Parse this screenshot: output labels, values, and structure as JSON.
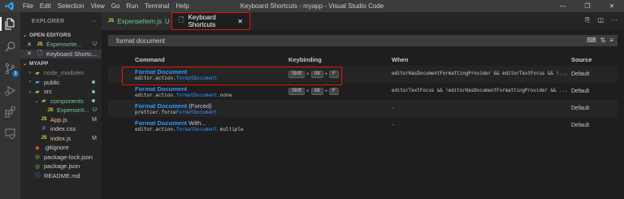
{
  "titlebar": {
    "menu": [
      "File",
      "Edit",
      "Selection",
      "View",
      "Go",
      "Run",
      "Terminal",
      "Help"
    ],
    "window_title": "Keyboard Shortcuts - myapp - Visual Studio Code"
  },
  "activity_icons": [
    "files-icon",
    "search-icon",
    "source-control-icon",
    "run-debug-icon",
    "extensions-icon",
    "remote-explorer-icon"
  ],
  "source_control_badge": "3",
  "sidebar": {
    "title": "EXPLORER",
    "open_editors_title": "OPEN EDITORS",
    "open_editors": [
      {
        "name": "ExpenseIte...",
        "status": "U"
      },
      {
        "name": "Keyboard Shortc...",
        "status": ""
      }
    ],
    "project_title": "MYAPP",
    "tree": [
      {
        "name": "node_modules",
        "status": ""
      },
      {
        "name": "public",
        "status": ""
      },
      {
        "name": "src",
        "status": ""
      },
      {
        "name": "components",
        "status": ""
      },
      {
        "name": "ExpenseIt...",
        "status": "U"
      },
      {
        "name": "App.js",
        "status": "M"
      },
      {
        "name": "index.css",
        "status": ""
      },
      {
        "name": "index.js",
        "status": "M"
      },
      {
        "name": ".gitignore",
        "status": ""
      },
      {
        "name": "package-lock.json",
        "status": ""
      },
      {
        "name": "package.json",
        "status": ""
      },
      {
        "name": "README.md",
        "status": ""
      }
    ]
  },
  "tabs": [
    {
      "label": "ExpenseItem.js",
      "status": "U"
    },
    {
      "label": "Keyboard Shortcuts",
      "close": "✕"
    }
  ],
  "search": {
    "value": "format document"
  },
  "table": {
    "headers": {
      "command": "Command",
      "keybinding": "Keybinding",
      "when": "When",
      "source": "Source"
    },
    "rows": [
      {
        "title": "Format Document",
        "title_suffix": "",
        "id_prefix": "editor.action.",
        "id_match": "formatDocument",
        "id_suffix": "",
        "keys": [
          "Shift",
          "Alt",
          "F"
        ],
        "when": "editorHasDocumentFormattingProvider && editorTextFocus && !...",
        "source": "Default"
      },
      {
        "title": "Format Document",
        "title_suffix": "",
        "id_prefix": "editor.action.",
        "id_match": "formatDocument",
        "id_suffix": ".none",
        "keys": [
          "Shift",
          "Alt",
          "F"
        ],
        "when": "editorTextFocus && !editorHasDocumentFormattingProvider && ...",
        "source": "Default"
      },
      {
        "title": "Format Document",
        "title_suffix": " (Forced)",
        "id_prefix": "prettier.force",
        "id_match": "FormatDocument",
        "id_suffix": "",
        "keys": [],
        "when": "-",
        "source": "Default"
      },
      {
        "title": "Format Document",
        "title_suffix": " With...",
        "id_prefix": "editor.action.",
        "id_match": "formatDocument",
        "id_suffix": ".multiple",
        "keys": [],
        "when": "-",
        "source": "Default"
      }
    ]
  },
  "colors": {
    "accent": "#3794ff",
    "highlight": "#e51400",
    "modified": "#e2c08d",
    "untracked": "#73c991"
  }
}
